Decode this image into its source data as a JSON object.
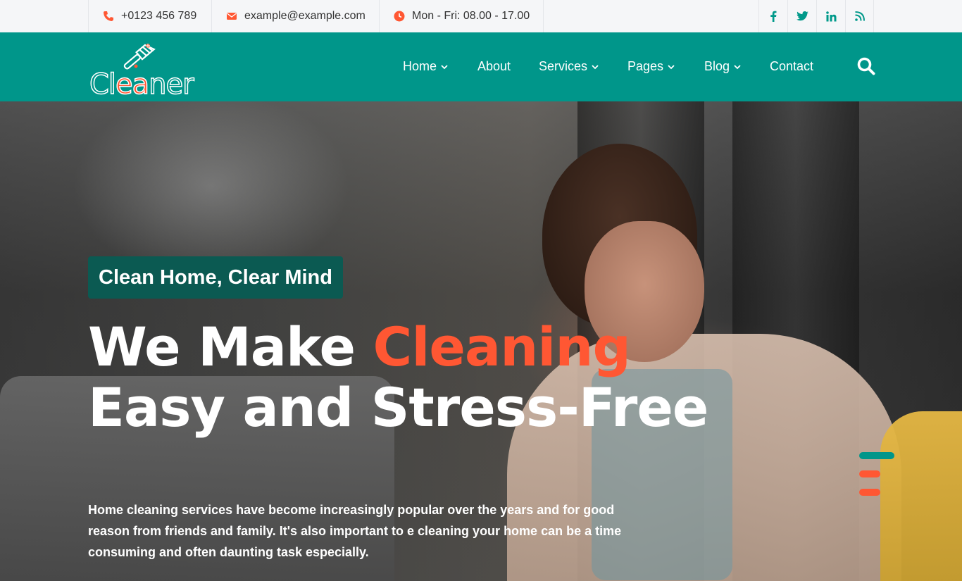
{
  "topbar": {
    "phone": "+0123 456 789",
    "email": "example@example.com",
    "hours": "Mon - Fri: 08.00 - 17.00",
    "social": [
      "facebook-icon",
      "twitter-icon",
      "linkedin-icon",
      "rss-icon"
    ]
  },
  "brand": {
    "logo_text_prefix": "Cl",
    "logo_text_accent": "ea",
    "logo_text_suffix": "ner"
  },
  "nav": {
    "items": [
      {
        "label": "Home",
        "dropdown": true
      },
      {
        "label": "About",
        "dropdown": false
      },
      {
        "label": "Services",
        "dropdown": true
      },
      {
        "label": "Pages",
        "dropdown": true
      },
      {
        "label": "Blog",
        "dropdown": true
      },
      {
        "label": "Contact",
        "dropdown": false
      }
    ]
  },
  "hero": {
    "badge": "Clean Home, Clear Mind",
    "headline_part1": "We Make ",
    "headline_highlight": "Cleaning",
    "headline_part2": "Easy and Stress-Free",
    "description": "Home cleaning services have become increasingly popular over the years and for good reason from friends and family. It's also important to e cleaning your home can be a time consuming and often daunting task especially."
  },
  "colors": {
    "brand": "#00968a",
    "accent": "#ff5733",
    "badge": "#0b5a52"
  }
}
